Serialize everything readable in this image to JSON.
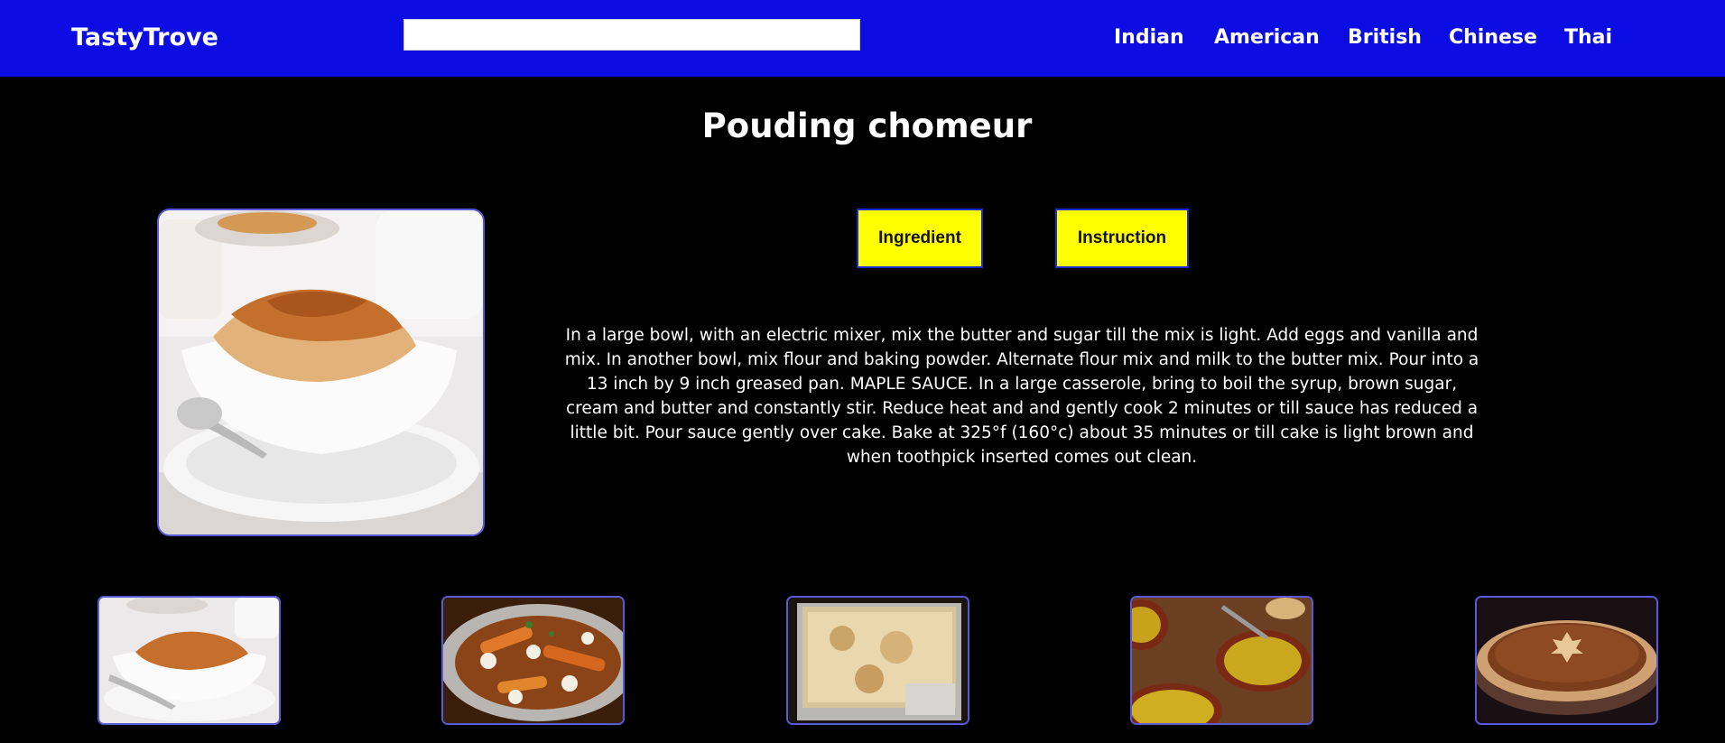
{
  "header": {
    "brand": "TastyTrove",
    "search": {
      "value": "",
      "placeholder": ""
    },
    "nav": [
      "Indian",
      "American",
      "British",
      "Chinese",
      "Thai"
    ],
    "background_color": "#0c0de3"
  },
  "recipe": {
    "title": "Pouding chomeur",
    "image": "pouding-chomeur-photo",
    "tabs": {
      "ingredient_label": "Ingredient",
      "instruction_label": "Instruction"
    },
    "instructions": "In a large bowl, with an electric mixer, mix the butter and sugar till the mix is light. Add eggs and vanilla and mix. In another bowl, mix flour and baking powder. Alternate flour mix and milk to the butter mix. Pour into a 13 inch by 9 inch greased pan. MAPLE SAUCE. In a large casserole, bring to boil the syrup, brown sugar, cream and butter and constantly stir. Reduce heat and and gently cook 2 minutes or till sauce has reduced a little bit. Pour sauce gently over cake. Bake at 325°f (160°c) about 35 minutes or till cake is light brown and when toothpick inserted comes out clean."
  },
  "related": [
    {
      "image": "pouding-chomeur-thumbnail"
    },
    {
      "image": "poutine-thumbnail"
    },
    {
      "image": "baked-casserole-thumbnail"
    },
    {
      "image": "pea-soup-thumbnail"
    },
    {
      "image": "maple-pie-thumbnail"
    }
  ],
  "colors": {
    "accent_button": "#ffff00",
    "button_border": "#1f2bd0",
    "image_border": "#5a5ad6",
    "page_background": "#000000"
  }
}
